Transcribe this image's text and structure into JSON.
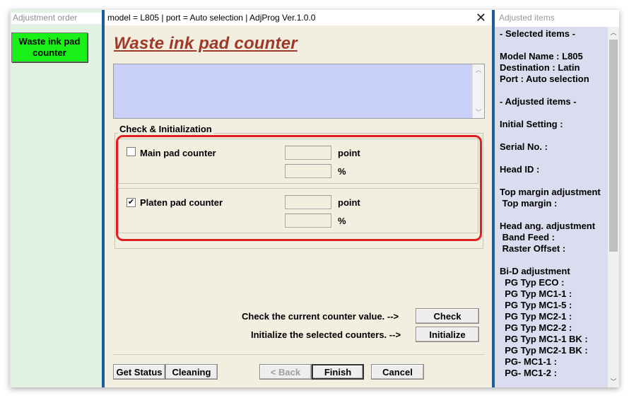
{
  "left_panel": {
    "title": "Adjustment order",
    "waste_button_label": "Waste ink pad counter"
  },
  "window": {
    "title": "model = L805 | port = Auto selection | AdjProg Ver.1.0.0",
    "close_label": "✕"
  },
  "main": {
    "page_title": "Waste ink pad counter",
    "message_box_text": "",
    "group_title": "Check & Initialization",
    "counters": [
      {
        "label": "Main pad counter",
        "checked": false,
        "checkmark": "",
        "unit_point": "point",
        "unit_percent": "%",
        "point_value": "",
        "percent_value": ""
      },
      {
        "label": "Platen pad counter",
        "checked": true,
        "checkmark": "✔",
        "unit_point": "point",
        "unit_percent": "%",
        "point_value": "",
        "percent_value": ""
      }
    ],
    "check_text": "Check the current counter value. -->",
    "check_button": "Check",
    "init_text": "Initialize the selected counters. -->",
    "init_button": "Initialize"
  },
  "footer": {
    "get_status": "Get Status",
    "cleaning": "Cleaning",
    "back": "< Back",
    "finish": "Finish",
    "cancel": "Cancel"
  },
  "right_panel": {
    "title": "Adjusted items",
    "lines": [
      "- Selected items -",
      "",
      "Model Name : L805",
      "Destination : Latin",
      "Port : Auto selection",
      "",
      "- Adjusted items -",
      "",
      "Initial Setting :",
      "",
      "Serial No. :",
      "",
      "Head ID :",
      "",
      "Top margin adjustment",
      " Top margin :",
      "",
      "Head ang. adjustment",
      " Band Feed :",
      " Raster Offset :",
      "",
      "Bi-D adjustment",
      "  PG Typ ECO :",
      "  PG Typ MC1-1 :",
      "  PG Typ MC1-5 :",
      "  PG Typ MC2-1 :",
      "  PG Typ MC2-2 :",
      "  PG Typ MC1-1 BK :",
      "  PG Typ MC2-1 BK :",
      "  PG- MC1-1 :",
      "  PG- MC1-2 :"
    ]
  },
  "colors": {
    "accent_title": "#a0392a",
    "highlight": "#e02020",
    "waste_button": "#18f018",
    "divider": "#1a5f9a"
  }
}
